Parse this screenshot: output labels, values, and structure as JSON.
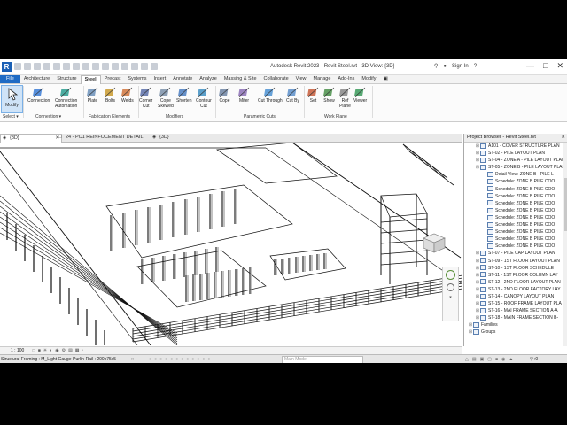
{
  "app": {
    "title": "Autodesk Revit 2023 - Revit Steel.rvt - 3D View: {3D}",
    "sign_in": "Sign In",
    "logo_letter": "R",
    "brand_color": "#1f6bc4"
  },
  "tabs": [
    "File",
    "Architecture",
    "Structure",
    "Steel",
    "Precast",
    "Systems",
    "Insert",
    "Annotate",
    "Analyze",
    "Massing & Site",
    "Collaborate",
    "View",
    "Manage",
    "Add-Ins",
    "Modify"
  ],
  "active_tab": "Steel",
  "ribbon": {
    "modify": "Modify",
    "tools": [
      {
        "label": "Connection",
        "icon": "connection-icon"
      },
      {
        "label": "Connection\nAutomation",
        "icon": "connection-automation-icon"
      },
      {
        "label": "Plate",
        "icon": "plate-icon"
      },
      {
        "label": "Bolts",
        "icon": "bolts-icon"
      },
      {
        "label": "Welds",
        "icon": "welds-icon"
      },
      {
        "label": "Corner\nCut",
        "icon": "corner-cut-icon"
      },
      {
        "label": "Cope\nSkewed",
        "icon": "cope-skewed-icon"
      },
      {
        "label": "Shorten",
        "icon": "shorten-icon"
      },
      {
        "label": "Contour\nCut",
        "icon": "contour-cut-icon"
      },
      {
        "label": "Cope",
        "icon": "cope-icon"
      },
      {
        "label": "Miter",
        "icon": "miter-icon"
      },
      {
        "label": "Cut Through",
        "icon": "cut-through-icon"
      },
      {
        "label": "Cut By",
        "icon": "cut-by-icon"
      },
      {
        "label": "Set",
        "icon": "set-icon"
      },
      {
        "label": "Show",
        "icon": "show-icon"
      },
      {
        "label": "Ref\nPlane",
        "icon": "ref-plane-icon"
      },
      {
        "label": "Viewer",
        "icon": "viewer-icon"
      }
    ],
    "panels": [
      "Select",
      "Connection",
      "Fabrication Elements",
      "Modifiers",
      "Parametric Cuts",
      "Work Plane"
    ]
  },
  "doc_tabs": [
    "{3D}",
    "24 - PC1 REINFOCEMENT DETAIL",
    "{3D}"
  ],
  "project_browser": {
    "title": "Project Browser - Revit Steel.rvt",
    "items": [
      {
        "t": "+",
        "label": "A101 - COVER STRUCTURE PLAN",
        "d": 1
      },
      {
        "t": "+",
        "label": "ST-02 - PILE LAYOUT PLAN",
        "d": 1
      },
      {
        "t": "+",
        "label": "ST-04 - ZONE A - PILE LAYOUT PLAN",
        "d": 1
      },
      {
        "t": "-",
        "label": "ST-05 - ZONE B - PILE LAYOUT PLAN",
        "d": 1
      },
      {
        "t": "",
        "label": "Detail View: ZONE B - PILE L",
        "d": 2
      },
      {
        "t": "",
        "label": "Schedule: ZONE B PILE COO",
        "d": 2
      },
      {
        "t": "",
        "label": "Schedule: ZONE B PILE COO",
        "d": 2
      },
      {
        "t": "",
        "label": "Schedule: ZONE B PILE COO",
        "d": 2
      },
      {
        "t": "",
        "label": "Schedule: ZONE B PILE COO",
        "d": 2
      },
      {
        "t": "",
        "label": "Schedule: ZONE B PILE COO",
        "d": 2
      },
      {
        "t": "",
        "label": "Schedule: ZONE B PILE COO",
        "d": 2
      },
      {
        "t": "",
        "label": "Schedule: ZONE B PILE COO",
        "d": 2
      },
      {
        "t": "",
        "label": "Schedule: ZONE B PILE COO",
        "d": 2
      },
      {
        "t": "",
        "label": "Schedule: ZONE B PILE COO",
        "d": 2
      },
      {
        "t": "",
        "label": "Schedule: ZONE B PILE COO",
        "d": 2
      },
      {
        "t": "+",
        "label": "ST-07 - PILE CAP LAYOUT PLAN",
        "d": 1
      },
      {
        "t": "+",
        "label": "ST-09 - 1ST FLOOR LAYOUT PLAN",
        "d": 1
      },
      {
        "t": "+",
        "label": "ST-10 - 1ST FLOOR SCHEDULE",
        "d": 1
      },
      {
        "t": "+",
        "label": "ST-11 - 1ST FLOOR COLUMN LAY",
        "d": 1
      },
      {
        "t": "+",
        "label": "ST-12 - 2ND FLOOR LAYOUT PLAN",
        "d": 1
      },
      {
        "t": "+",
        "label": "ST-13 - 2ND FLOOR FACTORY LAY",
        "d": 1
      },
      {
        "t": "+",
        "label": "ST-14 - CANOPY LAYOUT PLAN",
        "d": 1
      },
      {
        "t": "+",
        "label": "ST-15 - ROOF FRAME LAYOUT PLA",
        "d": 1
      },
      {
        "t": "+",
        "label": "ST-16 - MAI FRAME SECTION A-A",
        "d": 1
      },
      {
        "t": "+",
        "label": "ST-18 - MAIN FRAME SECTION B-",
        "d": 1
      },
      {
        "t": "+",
        "label": "Families",
        "d": 0
      },
      {
        "t": "+",
        "label": "Groups",
        "d": 0
      }
    ]
  },
  "view_control": {
    "scale": "1 : 100"
  },
  "status": {
    "left": "Structural Framing : M_Light Gauge-Purlin-Rail : 200x75x5",
    "model": "Main Model",
    "count": ":0"
  }
}
